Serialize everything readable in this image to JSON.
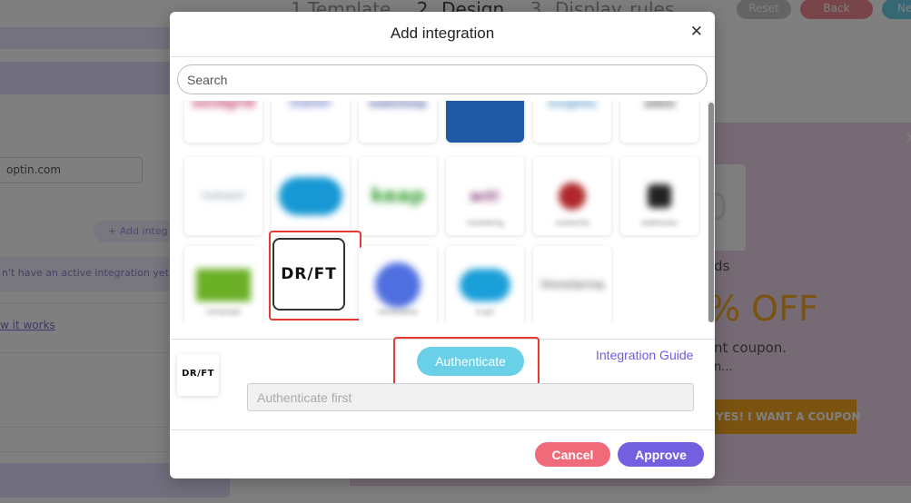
{
  "background": {
    "steps": [
      "1.Template",
      "2. Design",
      "3. Display rules"
    ],
    "reset_label": "Reset",
    "back_label": "Back",
    "next_label": "Ne",
    "email_value": "optin.com",
    "add_integration_label": "+ Add integ",
    "no_integration_note": "n't have an active integration yet.",
    "how_it_works_link": "w it works",
    "preview": {
      "counter_digit": "0",
      "counter_unit": "ds",
      "discount": "% OFF",
      "coupon_line": "nt coupon.",
      "coupon_line2": "n...",
      "cta_label": "YES! I WANT A COUPON"
    }
  },
  "modal": {
    "title": "Add integration",
    "search_placeholder": "Search",
    "selected_integration": "DRIFT",
    "drift_logo_text": "DR/FT",
    "authenticate_label": "Authenticate",
    "integration_guide_label": "Integration Guide",
    "auth_field_placeholder": "Authenticate first",
    "cancel_label": "Cancel",
    "approve_label": "Approve",
    "tiles_top_row": [
      {
        "name": "partial-brand-1",
        "color": "#c0396b"
      },
      {
        "name": "partial-brand-2",
        "color": "#6a7cc8"
      },
      {
        "name": "partial-brand-3",
        "color": "#3b4a9a"
      },
      {
        "name": "partial-brand-4",
        "color": "#1e5aa6"
      },
      {
        "name": "partial-brand-5",
        "color": "#4a8fc2"
      },
      {
        "name": "partial-brand-6",
        "color": "#333333"
      }
    ],
    "tiles_middle_row": [
      {
        "name": "blurred-brand-a",
        "color": "#9aa5b6"
      },
      {
        "name": "salesforce-like",
        "color": "#1798d4"
      },
      {
        "name": "keap-like",
        "color": "#37a136"
      },
      {
        "name": "blurred-brand-b",
        "color": "#7a2a6a"
      },
      {
        "name": "blurred-brand-c",
        "color": "#b0282c"
      },
      {
        "name": "blurred-brand-d",
        "color": "#222222"
      }
    ],
    "tiles_bottom_row": [
      {
        "name": "blurred-brand-e",
        "color": "#6bb026"
      },
      {
        "name": "blurred-brand-f",
        "color": "#4f6fe0"
      },
      {
        "name": "blurred-brand-g",
        "color": "#1a9fd8"
      },
      {
        "name": "blurred-brand-h",
        "color": "#6a6a6a"
      }
    ]
  },
  "colors": {
    "accent": "#7260e0",
    "authenticate": "#6ad0e8",
    "cancel": "#f06a79",
    "highlight": "#e53935"
  }
}
